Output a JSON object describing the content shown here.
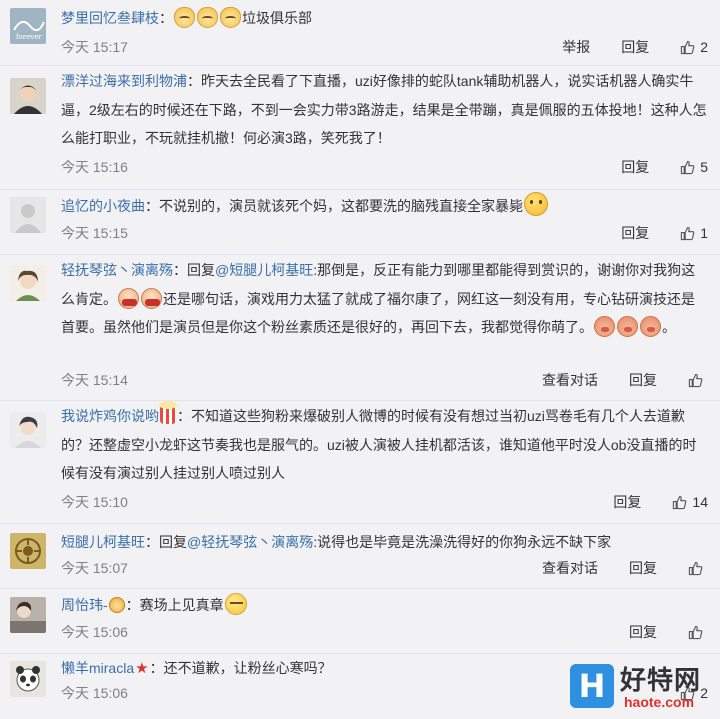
{
  "comments": [
    {
      "user": "梦里回忆叁肆枝",
      "segments": [
        {
          "type": "text",
          "value": "："
        },
        {
          "type": "emo",
          "kind": "cat"
        },
        {
          "type": "emo",
          "kind": "cat"
        },
        {
          "type": "emo",
          "kind": "cat"
        },
        {
          "type": "text",
          "value": "垃圾俱乐部"
        }
      ],
      "time": "今天 15:17",
      "actions": [
        "举报",
        "回复"
      ],
      "likes": "2"
    },
    {
      "user": "漂洋过海来到利物浦",
      "segments": [
        {
          "type": "text",
          "value": "：昨天去全民看了下直播，uzi好像排的蛇队tank辅助机器人，说实话机器人确实牛逼，2级左右的时候还在下路，不到一会实力带3路游走，结果是全带蹦，真是佩服的五体投地！这种人怎么能打职业，不玩就挂机撤！何必演3路，笑死我了！"
        }
      ],
      "time": "今天 15:16",
      "actions": [
        "回复"
      ],
      "likes": "5"
    },
    {
      "user": "追忆的小夜曲",
      "segments": [
        {
          "type": "text",
          "value": "：不说别的，演员就该死个妈，这都要洗的脑残直接全家暴毙"
        },
        {
          "type": "emo",
          "kind": "yellow"
        }
      ],
      "time": "今天 15:15",
      "actions": [
        "回复"
      ],
      "likes": "1"
    },
    {
      "user": "轻抚琴弦丶演离殇",
      "segments": [
        {
          "type": "text",
          "value": "：回复"
        },
        {
          "type": "mention",
          "value": "@短腿儿柯基旺"
        },
        {
          "type": "text",
          "value": ":那倒是，反正有能力到哪里都能得到赏识的，谢谢你对我狗这么肯定。"
        },
        {
          "type": "emo",
          "kind": "mask"
        },
        {
          "type": "emo",
          "kind": "mask"
        },
        {
          "type": "text",
          "value": "还是哪句话，演戏用力太猛了就成了福尔康了，网红这一刻没有用，专心钻研演技还是首要。虽然他们是演员但是你这个粉丝素质还是很好的，再回下去，我都觉得你萌了。"
        },
        {
          "type": "emo",
          "kind": "pig"
        },
        {
          "type": "emo",
          "kind": "pig"
        },
        {
          "type": "emo",
          "kind": "pig"
        },
        {
          "type": "text",
          "value": "。"
        }
      ],
      "time": "今天 15:14",
      "actions": [
        "查看对话",
        "回复"
      ],
      "likes": ""
    },
    {
      "user": "我说炸鸡你说哟",
      "segments": [
        {
          "type": "emo",
          "kind": "popcorn"
        },
        {
          "type": "text",
          "value": "：不知道这些狗粉来爆破别人微博的时候有没有想过当初uzi骂卷毛有几个人去道歉的？还整虚空小龙虾这节奏我也是服气的。uzi被人演被人挂机都活该，谁知道他平时没人ob没直播的时候有没有演过别人挂过别人喷过别人"
        }
      ],
      "time": "今天 15:10",
      "actions": [
        "回复"
      ],
      "likes": "14"
    },
    {
      "user": "短腿儿柯基旺",
      "segments": [
        {
          "type": "text",
          "value": "：回复"
        },
        {
          "type": "mention",
          "value": "@轻抚琴弦丶演离殇"
        },
        {
          "type": "text",
          "value": ":说得也是毕竟是洗澡洗得好的你狗永远不缺下家"
        }
      ],
      "time": "今天 15:07",
      "actions": [
        "查看对话",
        "回复"
      ],
      "likes": ""
    },
    {
      "user": "周怡玮-",
      "segments": [
        {
          "type": "emo",
          "kind": "bear"
        },
        {
          "type": "text",
          "value": "：赛场上见真章"
        },
        {
          "type": "emo",
          "kind": "smug"
        }
      ],
      "time": "今天 15:06",
      "actions": [
        "回复"
      ],
      "likes": ""
    },
    {
      "user": "懒羊miracla",
      "segments": [
        {
          "type": "emo",
          "kind": "star",
          "value": "★"
        },
        {
          "type": "text",
          "value": "：还不道歉，让粉丝心寒吗？"
        }
      ],
      "time": "今天 15:06",
      "actions": [],
      "likes": "2"
    }
  ],
  "watermark": {
    "logo": "H",
    "name": "好特网",
    "url": "haote.com"
  },
  "colors": {
    "link": "#3b6ea8",
    "text": "#333333",
    "time": "#808080",
    "background": "#f2f2f5"
  }
}
